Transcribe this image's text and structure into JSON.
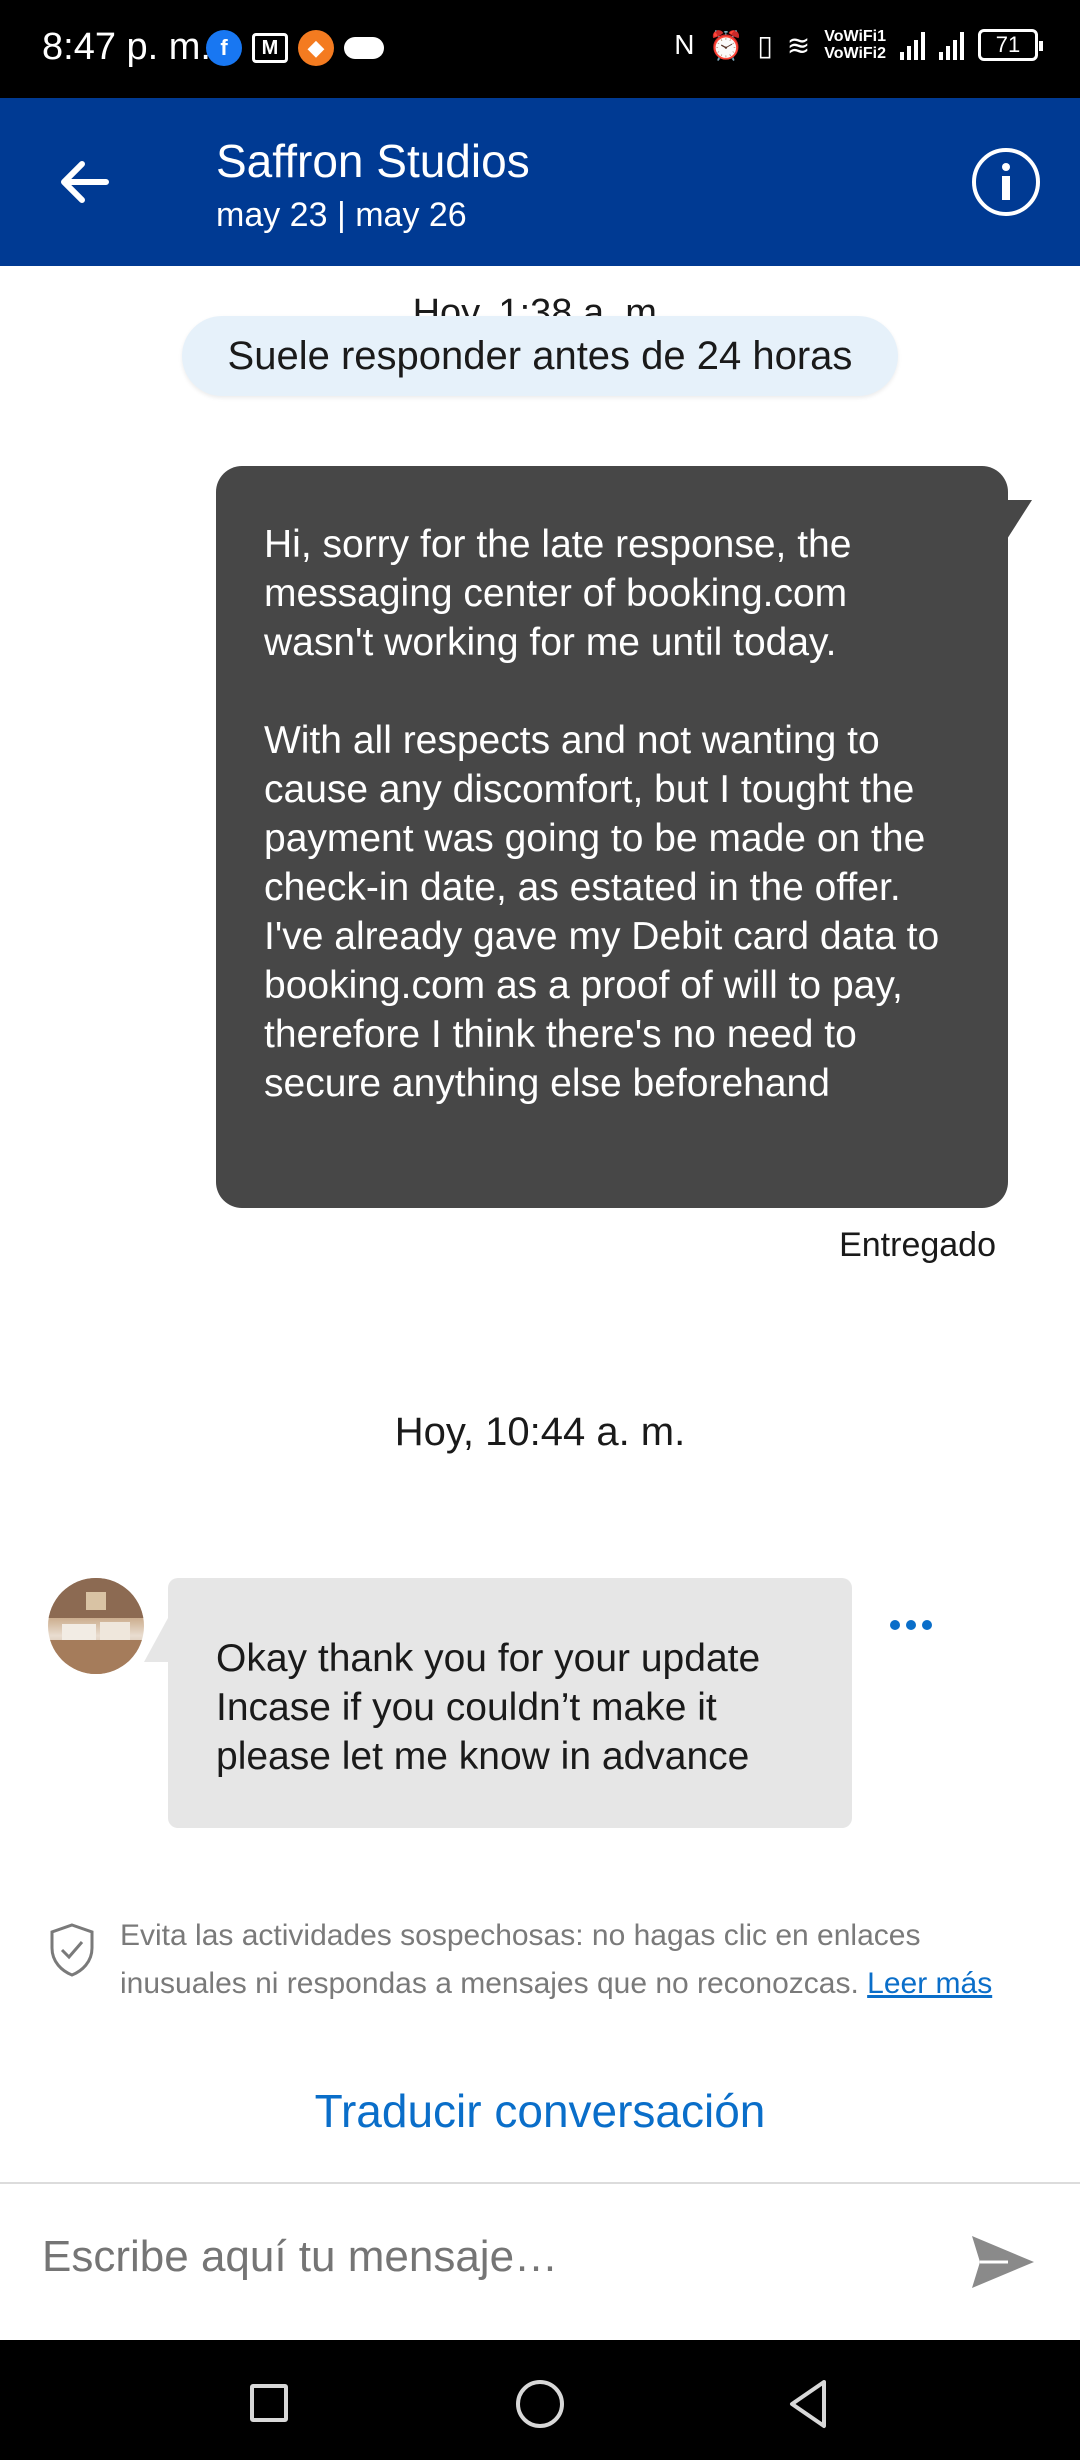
{
  "status_bar": {
    "time": "8:47 p. m.",
    "vowifi_1": "VoWiFi1",
    "vowifi_2": "VoWiFi2",
    "battery": "71"
  },
  "header": {
    "title": "Saffron Studios",
    "dates": "may 23 | may 26"
  },
  "chat": {
    "peek_timestamp": "Hoy, 1:38 a. m.",
    "response_pill": "Suele responder antes de 24 horas",
    "outgoing": {
      "paragraph_1": "Hi, sorry for the late response, the messaging center of booking.com wasn't working for me until today.",
      "paragraph_2": "With all respects and not wanting to cause any discomfort, but I tought the payment was going to be made on the check-in date, as estated in the offer. I've already gave my Debit card data to booking.com as a proof of will to pay, therefore I think there's no need to secure anything else beforehand",
      "status": "Entregado"
    },
    "day_separator": "Hoy, 10:44 a. m.",
    "incoming": {
      "text": "Okay thank you for your update Incase if you couldn’t make it please let me know in advance"
    }
  },
  "safety": {
    "text": "Evita las actividades sospechosas: no hagas clic en enlaces inusuales ni respondas a mensajes que no reconozcas.",
    "link": "Leer más"
  },
  "translate_label": "Traducir conversación",
  "composer": {
    "placeholder": "Escribe aquí tu mensaje…"
  },
  "colors": {
    "header_bg": "#003a93",
    "outgoing_bubble": "#474747",
    "incoming_bubble": "#e6e6e6",
    "link": "#0a6ec9",
    "pill_bg": "#e6f1fa"
  }
}
